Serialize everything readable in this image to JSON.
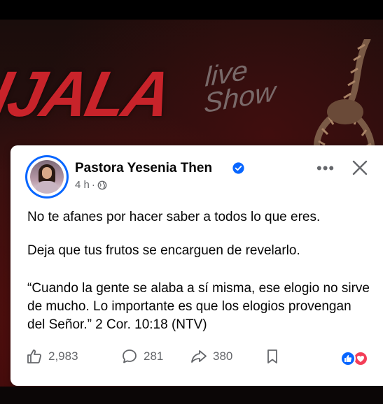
{
  "background": {
    "logo_text": "IJALA",
    "logo_sub": "live Show"
  },
  "post": {
    "author": "Pastora Yesenia Then",
    "time": "4 h",
    "separator": "·",
    "paragraphs": [
      "No te afanes por hacer saber a todos lo que eres.",
      "Deja que tus frutos se encarguen de revelarlo.",
      "“Cuando la gente se alaba a sí misma, ese elogio no sirve de mucho. Lo importante es que los elogios provengan del Señor.” 2 Cor. 10:18 (NTV)"
    ],
    "more_label": "•••",
    "likes": "2,983",
    "comments": "281",
    "shares": "380"
  },
  "colors": {
    "accent": "#0866ff",
    "love": "#f33e58",
    "brand_red": "#c8232a"
  },
  "icons": [
    "verified-badge-icon",
    "globe-icon",
    "more-icon",
    "close-icon",
    "like-icon",
    "comment-icon",
    "share-icon",
    "bookmark-icon",
    "like-reaction-icon",
    "love-reaction-icon"
  ]
}
